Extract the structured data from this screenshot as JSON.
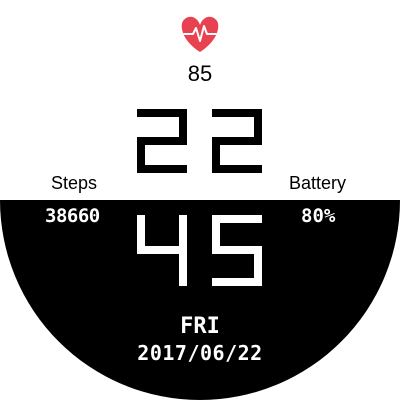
{
  "colors": {
    "background": "#ffffff",
    "dial_lower_half": "#000000",
    "digits_top": "#000000",
    "digits_bottom": "#ffffff",
    "heart": "#e8414f"
  },
  "icons": {
    "heart": "heart-pulse-icon"
  },
  "heart_rate": {
    "value": "85"
  },
  "time": {
    "hours": "22",
    "minutes": "45"
  },
  "steps": {
    "label": "Steps",
    "value": "38660"
  },
  "battery": {
    "label": "Battery",
    "value": "80%"
  },
  "date": {
    "day": "FRI",
    "date": "2017/06/22"
  }
}
